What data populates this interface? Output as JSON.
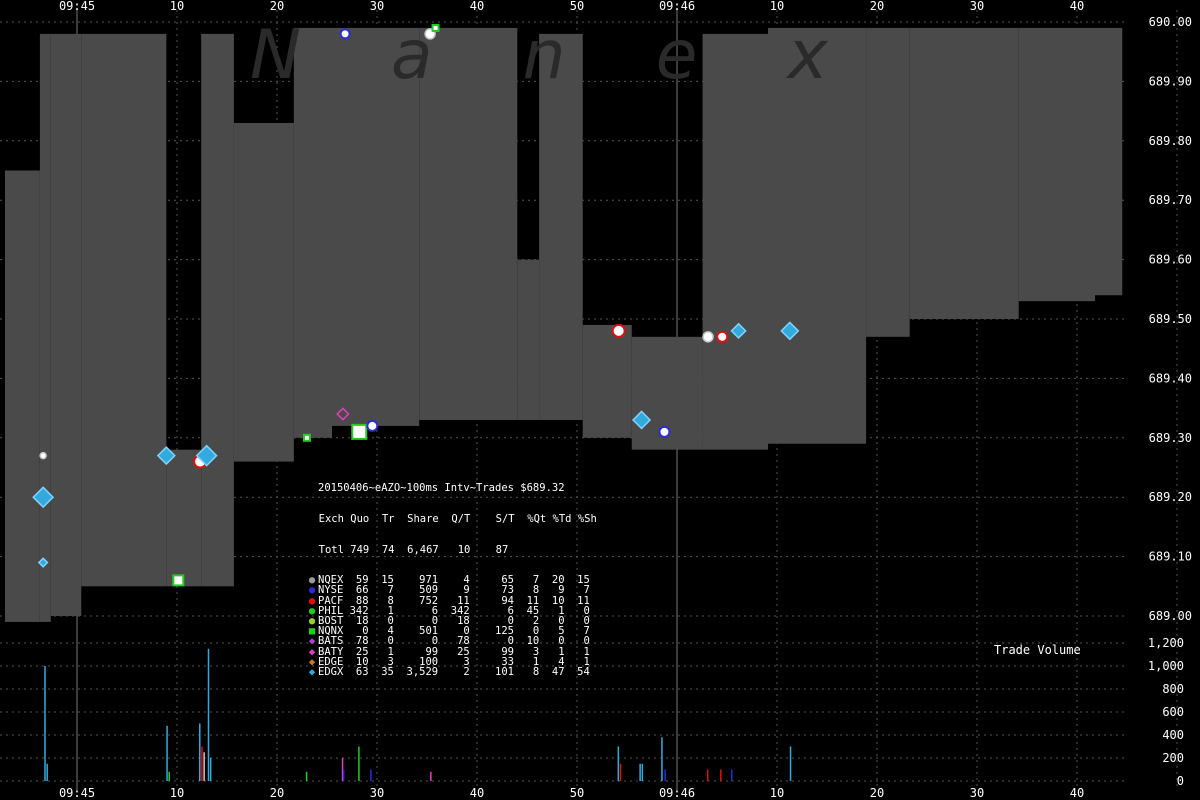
{
  "chart_data": [
    {
      "type": "area",
      "name": "price-chart",
      "ylim": [
        688.98,
        690.02
      ],
      "y_ticks": [
        "689.00",
        "689.10",
        "689.20",
        "689.30",
        "689.40",
        "689.50",
        "689.60",
        "689.70",
        "689.80",
        "689.90",
        "690.00"
      ],
      "x_tick_labels": [
        "09:45",
        "10",
        "20",
        "30",
        "40",
        "50",
        "09:46",
        "10",
        "20",
        "30",
        "40"
      ],
      "watermark": "Nanex",
      "spread_band": [
        {
          "t": 0,
          "bid": 688.99,
          "ask": 689.75
        },
        {
          "t": 3.2,
          "bid": 688.99,
          "ask": 689.98
        },
        {
          "t": 4.2,
          "bid": 689.0,
          "ask": 689.98
        },
        {
          "t": 7.0,
          "bid": 689.05,
          "ask": 689.98
        },
        {
          "t": 14.8,
          "bid": 689.05,
          "ask": 689.28
        },
        {
          "t": 18.0,
          "bid": 689.05,
          "ask": 689.98
        },
        {
          "t": 21.0,
          "bid": 689.26,
          "ask": 689.83
        },
        {
          "t": 26.5,
          "bid": 689.3,
          "ask": 689.99
        },
        {
          "t": 30.0,
          "bid": 689.32,
          "ask": 689.99
        },
        {
          "t": 38.0,
          "bid": 689.33,
          "ask": 689.99
        },
        {
          "t": 47.0,
          "bid": 689.33,
          "ask": 689.6
        },
        {
          "t": 49.0,
          "bid": 689.33,
          "ask": 689.98
        },
        {
          "t": 53.0,
          "bid": 689.3,
          "ask": 689.49
        },
        {
          "t": 57.5,
          "bid": 689.28,
          "ask": 689.47
        },
        {
          "t": 64.0,
          "bid": 689.28,
          "ask": 689.98
        },
        {
          "t": 70.0,
          "bid": 689.29,
          "ask": 689.99
        },
        {
          "t": 79.0,
          "bid": 689.47,
          "ask": 689.99
        },
        {
          "t": 83.0,
          "bid": 689.5,
          "ask": 689.99
        },
        {
          "t": 93.0,
          "bid": 689.53,
          "ask": 689.99
        },
        {
          "t": 100.0,
          "bid": 689.54,
          "ask": 689.99
        },
        {
          "t": 102.5,
          "bid": 689.54,
          "ask": 689.99
        }
      ],
      "trades": [
        {
          "t": 3.5,
          "price": 689.2,
          "exch": "EDGX",
          "size": 10
        },
        {
          "t": 3.5,
          "price": 689.27,
          "exch": "NQEX",
          "size": 2
        },
        {
          "t": 3.5,
          "price": 689.09,
          "exch": "EDGX",
          "size": 2
        },
        {
          "t": 14.8,
          "price": 689.27,
          "exch": "EDGX",
          "size": 8
        },
        {
          "t": 15.9,
          "price": 689.06,
          "exch": "NQNX",
          "size": 6
        },
        {
          "t": 17.9,
          "price": 689.26,
          "exch": "PACF",
          "size": 8
        },
        {
          "t": 18.5,
          "price": 689.27,
          "exch": "EDGX",
          "size": 10
        },
        {
          "t": 27.7,
          "price": 689.3,
          "exch": "NQNX",
          "size": 2
        },
        {
          "t": 31.0,
          "price": 689.34,
          "exch": "BATY",
          "size": 4
        },
        {
          "t": 32.5,
          "price": 689.31,
          "exch": "NQNX",
          "size": 10
        },
        {
          "t": 33.7,
          "price": 689.32,
          "exch": "NYSE",
          "size": 6
        },
        {
          "t": 31.2,
          "price": 689.98,
          "exch": "NYSE",
          "size": 5
        },
        {
          "t": 39.0,
          "price": 689.98,
          "exch": "NQEX",
          "size": 6
        },
        {
          "t": 39.5,
          "price": 689.99,
          "exch": "NQNX",
          "size": 2
        },
        {
          "t": 56.3,
          "price": 689.48,
          "exch": "PACF",
          "size": 8
        },
        {
          "t": 58.4,
          "price": 689.33,
          "exch": "EDGX",
          "size": 8
        },
        {
          "t": 60.5,
          "price": 689.31,
          "exch": "NYSE",
          "size": 6
        },
        {
          "t": 64.5,
          "price": 689.47,
          "exch": "NQEX",
          "size": 6
        },
        {
          "t": 65.8,
          "price": 689.47,
          "exch": "PACF",
          "size": 6
        },
        {
          "t": 67.3,
          "price": 689.48,
          "exch": "EDGX",
          "size": 6
        },
        {
          "t": 72.0,
          "price": 689.48,
          "exch": "EDGX",
          "size": 8
        }
      ]
    },
    {
      "type": "bar",
      "name": "trade-volume",
      "title": "Trade Volume",
      "ylim": [
        0,
        1200
      ],
      "y_ticks": [
        "0",
        "200",
        "400",
        "600",
        "800",
        "1,000",
        "1,200"
      ],
      "bars": [
        {
          "t": 3.6,
          "value": 1000,
          "exch": "EDGX"
        },
        {
          "t": 3.8,
          "value": 150,
          "exch": "EDGX"
        },
        {
          "t": 14.8,
          "value": 480,
          "exch": "EDGX"
        },
        {
          "t": 15.0,
          "value": 80,
          "exch": "NQNX"
        },
        {
          "t": 17.8,
          "value": 500,
          "exch": "EDGX"
        },
        {
          "t": 18.0,
          "value": 300,
          "exch": "PACF"
        },
        {
          "t": 18.2,
          "value": 250,
          "exch": "NQEX"
        },
        {
          "t": 18.6,
          "value": 1150,
          "exch": "EDGX"
        },
        {
          "t": 18.8,
          "value": 200,
          "exch": "EDGX"
        },
        {
          "t": 27.6,
          "value": 80,
          "exch": "NQNX"
        },
        {
          "t": 30.9,
          "value": 200,
          "exch": "BATY"
        },
        {
          "t": 31.0,
          "value": 100,
          "exch": "NYSE"
        },
        {
          "t": 32.4,
          "value": 300,
          "exch": "NQNX"
        },
        {
          "t": 33.5,
          "value": 100,
          "exch": "NYSE"
        },
        {
          "t": 39.0,
          "value": 80,
          "exch": "BATY"
        },
        {
          "t": 56.2,
          "value": 300,
          "exch": "EDGX"
        },
        {
          "t": 56.4,
          "value": 150,
          "exch": "PACF"
        },
        {
          "t": 58.2,
          "value": 150,
          "exch": "EDGX"
        },
        {
          "t": 58.4,
          "value": 150,
          "exch": "EDGX"
        },
        {
          "t": 60.2,
          "value": 380,
          "exch": "EDGX"
        },
        {
          "t": 60.5,
          "value": 100,
          "exch": "NYSE"
        },
        {
          "t": 64.4,
          "value": 100,
          "exch": "PACF"
        },
        {
          "t": 65.6,
          "value": 100,
          "exch": "PACF"
        },
        {
          "t": 66.6,
          "value": 100,
          "exch": "NYSE"
        },
        {
          "t": 72.0,
          "value": 300,
          "exch": "EDGX"
        }
      ]
    }
  ],
  "stats": {
    "header": "20150406~eAZO~100ms Intv~Trades $689.32",
    "columns": "  Exch Quo  Tr  Share  Q/T    S/T  %Qt %Td %Sh",
    "total": "  Totl 749  74  6,467   10    87",
    "rows": [
      {
        "text": "NQEX  59  15    971    4     65   7  20  15",
        "color": "#9a9a9a"
      },
      {
        "text": "NYSE  66   7    509    9     73   8   9   7",
        "color": "#2b2bd6"
      },
      {
        "text": "PACF  88   8    752   11     94  11  10  11",
        "color": "#e01010"
      },
      {
        "text": "PHIL 342   1      6  342      6  45   1   0",
        "color": "#22cc22"
      },
      {
        "text": "BOST  18   0      0   18      0   2   0   0",
        "color": "#9acd32"
      },
      {
        "text": "NQNX   0   4    501    0    125   0   5   7",
        "color": "#22cc22"
      },
      {
        "text": "BATS  78   0      0   78      0  10   0   0",
        "color": "#b040d0"
      },
      {
        "text": "BATY  25   1     99   25     99   3   1   1",
        "color": "#e040c0"
      },
      {
        "text": "EDGE  10   3    100    3     33   1   4   1",
        "color": "#c08020"
      },
      {
        "text": "EDGX  63  35  3,529    2    101   8  47  54",
        "color": "#33aadd"
      }
    ]
  },
  "exch_colors": {
    "NQEX": "#c8c8c8",
    "NYSE": "#2b2bd6",
    "PACF": "#e01010",
    "NQNX": "#22cc22",
    "BATY": "#e040c0",
    "EDGX": "#33aadd"
  },
  "colors": {
    "band": "#4a4a4a",
    "grid": "#555555",
    "axis_text": "#ffffff"
  }
}
